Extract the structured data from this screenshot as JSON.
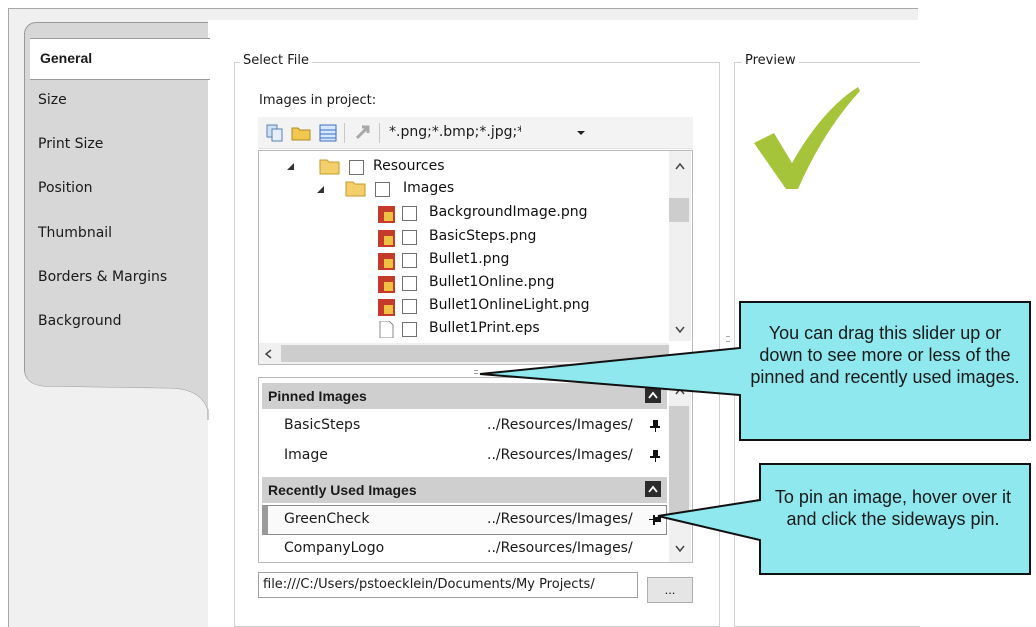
{
  "tabs": [
    {
      "label": "General",
      "selected": true
    },
    {
      "label": "Size"
    },
    {
      "label": "Print Size"
    },
    {
      "label": "Position"
    },
    {
      "label": "Thumbnail"
    },
    {
      "label": "Borders & Margins"
    },
    {
      "label": "Background"
    }
  ],
  "select_file": {
    "group_title": "Select File",
    "images_label": "Images in project:",
    "filter_value": "*.png;*.bmp;*.jpg;*",
    "tree": {
      "folder1": "Resources",
      "folder2": "Images",
      "files": [
        "BackgroundImage.png",
        "BasicSteps.png",
        "Bullet1.png",
        "Bullet1Online.png",
        "Bullet1OnlineLight.png",
        "Bullet1Print.eps"
      ]
    },
    "pinned_header": "Pinned Images",
    "pinned": [
      {
        "name": "BasicSteps",
        "path": "../Resources/Images/"
      },
      {
        "name": "Image",
        "path": "../Resources/Images/"
      }
    ],
    "recent_header": "Recently Used Images",
    "recent": [
      {
        "name": "GreenCheck",
        "path": "../Resources/Images/"
      },
      {
        "name": "CompanyLogo",
        "path": "../Resources/Images/"
      }
    ],
    "path_value": "file:///C:/Users/pstoecklein/Documents/My Projects/",
    "browse_label": "..."
  },
  "preview": {
    "group_title": "Preview"
  },
  "callouts": {
    "slider": "You can drag this slider up or down to see more or less of the pinned and recently used images.",
    "pin": "To pin an image, hover over it and click the sideways pin."
  },
  "colors": {
    "check_green": "#a6c43a",
    "callout_fill": "#8ee8ee",
    "callout_border": "#111111"
  }
}
